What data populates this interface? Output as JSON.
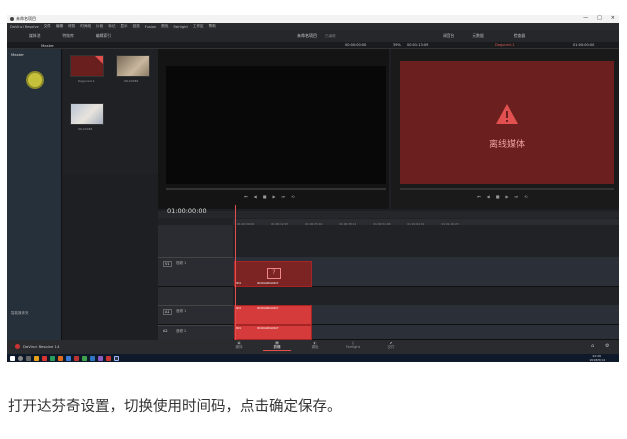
{
  "window": {
    "title": "未命名项目",
    "controls": [
      "—",
      "□",
      "×"
    ]
  },
  "menu": [
    "DaVinci Resolve",
    "文件",
    "编辑",
    "修剪",
    "时间线",
    "片段",
    "标记",
    "显示",
    "回放",
    "Fusion",
    "颜色",
    "Fairlight",
    "工作区",
    "帮助"
  ],
  "toolbar": {
    "media_pool": "媒体池",
    "effects": "特效库",
    "edit_index": "编辑索引",
    "project_name": "未命名项目",
    "edited": "已编辑",
    "audio_mixer": "调音台",
    "metadata": "元数据",
    "inspector": "检查器"
  },
  "media_panel": {
    "bin": "Master",
    "clips": [
      {
        "name": "Degunerl-1"
      },
      {
        "name": "IOL00082"
      },
      {
        "name": "IOL00084"
      }
    ]
  },
  "left_panel": {
    "smart_bins": "智能媒体夹"
  },
  "source_viewer": {
    "timecode_left": "00:00:00:00",
    "zoom": "39%",
    "timecode_right": "00:01:13:09"
  },
  "timeline_viewer": {
    "name": "Degunerl-1",
    "timecode": "01:00:00:00",
    "offline_text": "离线媒体"
  },
  "timeline": {
    "timecode": "01:00:00:00",
    "ruler": [
      "01:00:00:00",
      "01:00:12:25",
      "01:00:25:16",
      "01:00:38:11",
      "01:00:51:06",
      "01:01:04:01",
      "01:01:16:23"
    ],
    "tracks": [
      {
        "id": "V1",
        "name": "视频 1"
      },
      {
        "id": "A1",
        "name": "音频 1"
      },
      {
        "id": "A2",
        "name": "音频 2"
      }
    ],
    "clip_labels": [
      "IIO1",
      "IIO1OG000L0017"
    ]
  },
  "pages": [
    {
      "label": "媒体"
    },
    {
      "label": "剪辑"
    },
    {
      "label": "调色"
    },
    {
      "label": "Fairlight"
    },
    {
      "label": "交付"
    }
  ],
  "app_label": "DaVinci Resolve 14",
  "taskbar": {
    "time": "22:26",
    "date": "2018/5/14"
  },
  "caption": "打开达芬奇设置，切换使用时间码，点击确定保存。",
  "colors": {
    "offline_red": "#6b1f1f",
    "clip_red": "#d63b3b",
    "accent": "#e24f4f"
  }
}
